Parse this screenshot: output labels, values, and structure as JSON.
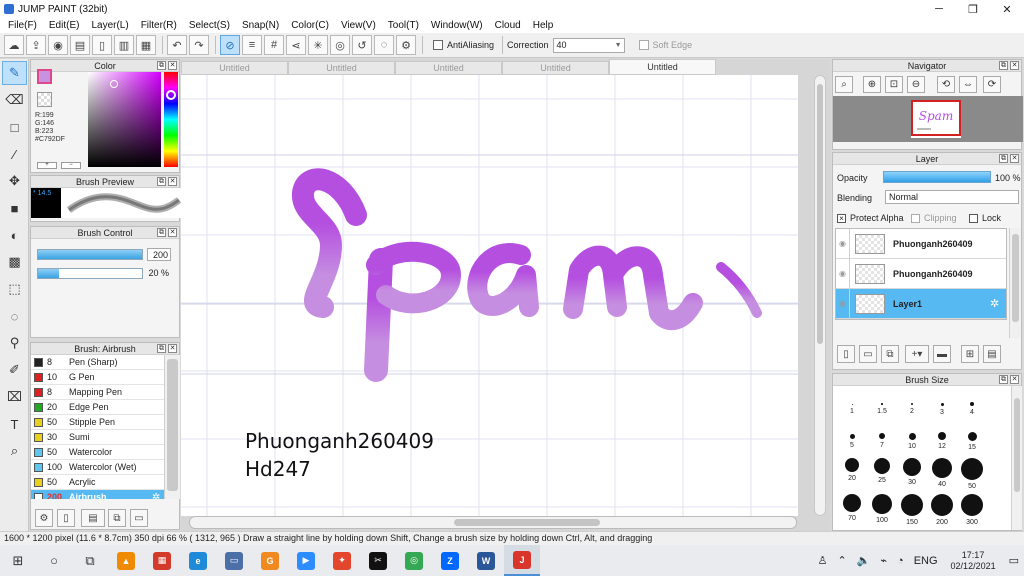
{
  "window": {
    "title": "JUMP PAINT (32bit)",
    "controls": [
      "─",
      "❐",
      "✕"
    ]
  },
  "menu": [
    "File(F)",
    "Edit(E)",
    "Layer(L)",
    "Filter(R)",
    "Select(S)",
    "Snap(N)",
    "Color(C)",
    "View(V)",
    "Tool(T)",
    "Window(W)",
    "Cloud",
    "Help"
  ],
  "toolbar": {
    "antialiasing_label": "AntiAliasing",
    "correction_label": "Correction",
    "correction_value": "40",
    "soft_edge_label": "Soft Edge"
  },
  "color_panel": {
    "title": "Color",
    "foreground": "#c792df",
    "readout": [
      "R:199",
      "G:146",
      "B:223",
      "#C792DF"
    ]
  },
  "brush_preview": {
    "title": "Brush Preview",
    "size": "* 14.5"
  },
  "brush_control": {
    "title": "Brush Control",
    "size_value": "200",
    "size_fill": 1.0,
    "opacity_value": "20 %",
    "opacity_fill": 0.2
  },
  "brush_panel": {
    "title": "Brush: Airbrush",
    "items": [
      {
        "color": "#222222",
        "size": "8",
        "name": "Pen (Sharp)"
      },
      {
        "color": "#e02020",
        "size": "10",
        "name": "G Pen"
      },
      {
        "color": "#e02020",
        "size": "8",
        "name": "Mapping Pen"
      },
      {
        "color": "#22aa22",
        "size": "20",
        "name": "Edge Pen"
      },
      {
        "color": "#e8d020",
        "size": "50",
        "name": "Stipple Pen"
      },
      {
        "color": "#e8d020",
        "size": "30",
        "name": "Sumi"
      },
      {
        "color": "#5ec6f0",
        "size": "50",
        "name": "Watercolor"
      },
      {
        "color": "#5ec6f0",
        "size": "100",
        "name": "Watercolor (Wet)"
      },
      {
        "color": "#e8d020",
        "size": "50",
        "name": "Acrylic"
      },
      {
        "color": "#ffffff",
        "size": "200",
        "name": "Airbrush",
        "selected": true
      }
    ]
  },
  "tabs": [
    "Untitled",
    "Untitled",
    "Untitled",
    "Untitled",
    "Untitled"
  ],
  "canvas": {
    "lettering": "Spam",
    "lettering_color_top": "#b54fe0",
    "lettering_color_bottom": "#c58ee0",
    "text_lines": [
      "Phuonganh260409",
      "Hd247"
    ]
  },
  "navigator": {
    "title": "Navigator",
    "thumb_text": "Spam"
  },
  "layer_panel": {
    "title": "Layer",
    "opacity_label": "Opacity",
    "opacity_value": "100 %",
    "blending_label": "Blending",
    "blending_value": "Normal",
    "protect_alpha": "Protect Alpha",
    "clipping": "Clipping",
    "lock": "Lock",
    "layers": [
      {
        "name": "Phuonganh260409",
        "selected": false
      },
      {
        "name": "Phuonganh260409",
        "selected": false
      },
      {
        "name": "Layer1",
        "selected": true
      }
    ]
  },
  "brush_size_panel": {
    "title": "Brush Size",
    "sizes": [
      "1",
      "1.5",
      "2",
      "3",
      "4",
      "5",
      "7",
      "10",
      "12",
      "15",
      "20",
      "25",
      "30",
      "40",
      "50",
      "70",
      "100",
      "150",
      "200",
      "300"
    ]
  },
  "status": {
    "text": "1600 * 1200 pixel   (11.6 * 8.7cm)   350 dpi   66 %   ( 1312, 965 )   Draw a straight line by holding down Shift, Change a brush size by holding down Ctrl, Alt, and dragging"
  },
  "taskbar": {
    "language": "ENG",
    "time": "17:17",
    "date": "02/12/2021",
    "apps": [
      "windows-start",
      "cortana",
      "task-view",
      "vlc",
      "explorer-a",
      "edge",
      "files",
      "ps",
      "zoom",
      "app-x",
      "capcut",
      "chrome",
      "zalo",
      "word",
      "jump-paint"
    ]
  }
}
